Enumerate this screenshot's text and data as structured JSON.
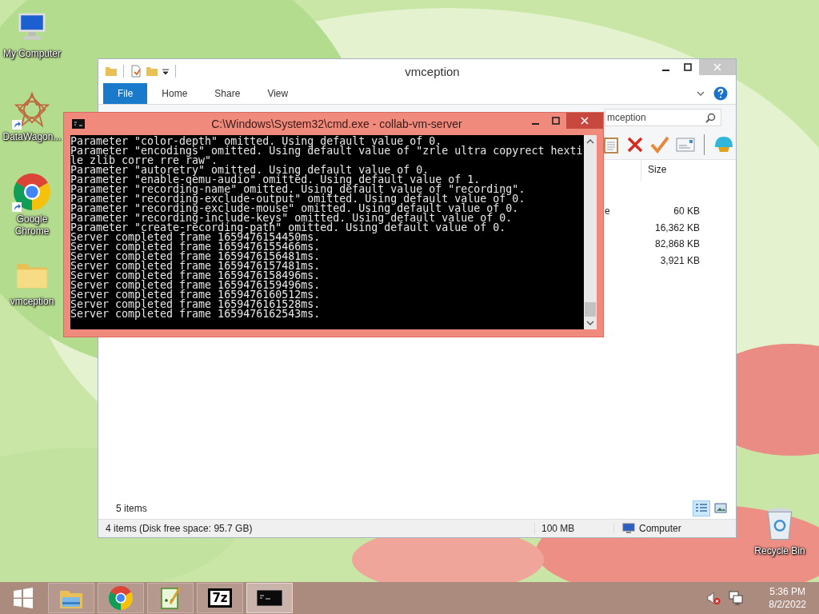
{
  "desktop_icons": [
    {
      "label": "My Computer",
      "kind": "computer"
    },
    {
      "label": "DataWagon...",
      "kind": "star",
      "shortcut": true
    },
    {
      "label": "Google Chrome",
      "kind": "chrome",
      "shortcut": true
    },
    {
      "label": "vmception",
      "kind": "folder",
      "shortcut": false
    },
    {
      "label": "Recycle Bin",
      "kind": "recycle"
    }
  ],
  "explorer": {
    "title": "vmception",
    "ribbon_tabs": [
      {
        "label": "File",
        "selected": true
      },
      {
        "label": "Home",
        "selected": false
      },
      {
        "label": "Share",
        "selected": false
      },
      {
        "label": "View",
        "selected": false
      }
    ],
    "search": {
      "value": "mception"
    },
    "columns": [
      {
        "label": "Size"
      }
    ],
    "rows": [
      {
        "type": "e",
        "size": "60 KB"
      },
      {
        "size": "16,362 KB"
      },
      {
        "size": "82,868 KB"
      },
      {
        "size": "3,921 KB"
      }
    ],
    "item_count": "5 items",
    "view_buttons": [
      {
        "kind": "details",
        "selected": true
      },
      {
        "kind": "large",
        "selected": false
      }
    ],
    "status_bar": {
      "items": "4 items (Disk free space: 95.7 GB)",
      "size": "100 MB",
      "location": "Computer"
    }
  },
  "console": {
    "title": "C:\\Windows\\System32\\cmd.exe - collab-vm-server",
    "lines": [
      "Parameter \"color-depth\" omitted. Using default value of 0.",
      "Parameter \"encodings\" omitted. Using default value of \"zrle ultra copyrect hexti",
      "le zlib corre rre raw\".",
      "Parameter \"autoretry\" omitted. Using default value of 0.",
      "Parameter \"enable-qemu-audio\" omitted. Using default value of 1.",
      "Parameter \"recording-name\" omitted. Using default value of \"recording\".",
      "Parameter \"recording-exclude-output\" omitted. Using default value of 0.",
      "Parameter \"recording-exclude-mouse\" omitted. Using default value of 0.",
      "Parameter \"recording-include-keys\" omitted. Using default value of 0.",
      "Parameter \"create-recording-path\" omitted. Using default value of 0.",
      "Server completed frame 1659476154450ms.",
      "Server completed frame 1659476155466ms.",
      "Server completed frame 1659476156481ms.",
      "Server completed frame 1659476157481ms.",
      "Server completed frame 1659476158496ms.",
      "Server completed frame 1659476159496ms.",
      "Server completed frame 1659476160512ms.",
      "Server completed frame 1659476161528ms.",
      "Server completed frame 1659476162543ms."
    ]
  },
  "taskbar": {
    "buttons": [
      {
        "kind": "explorer",
        "active": false
      },
      {
        "kind": "chrome",
        "active": false
      },
      {
        "kind": "notepad",
        "active": false
      },
      {
        "kind": "archiver",
        "label": "7z",
        "active": false
      },
      {
        "kind": "console",
        "active": true
      }
    ],
    "volume_muted": true,
    "clock": {
      "time": "5:36 PM",
      "date": "8/2/2022"
    }
  }
}
